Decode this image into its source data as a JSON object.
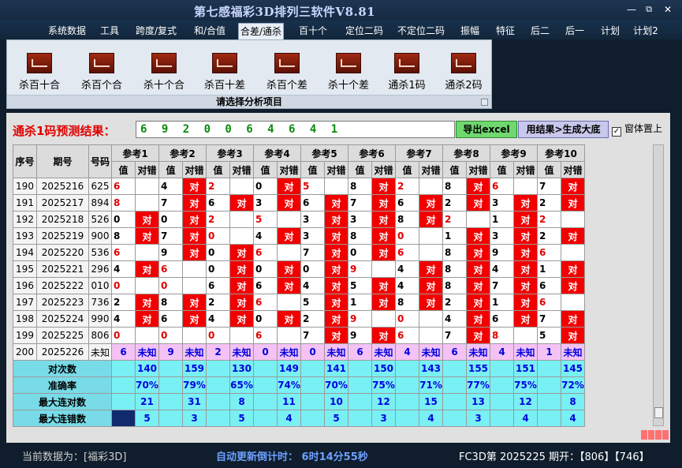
{
  "app": {
    "title": "第七感福彩3D排列三软件V8.81",
    "min": "—",
    "max": "⧉",
    "close": "✕"
  },
  "menu": [
    "系统数据",
    "工具",
    "跨度/复式",
    "和/合值",
    "合差/通杀",
    "百十个",
    "定位二码",
    "不定位二码",
    "振幅",
    "特征",
    "后二",
    "后一",
    "计划",
    "计划2"
  ],
  "menu_active": "合差/通杀",
  "ribbon": {
    "buttons": [
      "杀百十合",
      "杀百个合",
      "杀十个合",
      "杀百十差",
      "杀百个差",
      "杀十个差",
      "通杀1码",
      "通杀2码"
    ],
    "caption": "请选择分析项目"
  },
  "prediction": {
    "label": "通杀1码预测结果：",
    "value": "6 9 2 0 0 6 4 6 4 1",
    "export_label": "导出excel",
    "generate_label": "用结果>生成大底",
    "topmost_label": "窗体置上",
    "topmost_checked": true
  },
  "table": {
    "headers": {
      "seq": "序号",
      "period": "期号",
      "number": "号码",
      "ref_prefix": "参考",
      "value": "值",
      "result": "对错"
    },
    "refs": [
      "参考1",
      "参考2",
      "参考3",
      "参考4",
      "参考5",
      "参考6",
      "参考7",
      "参考8",
      "参考9",
      "参考10"
    ],
    "hit_text": "对",
    "rows": [
      {
        "seq": "190",
        "period": "2025216",
        "number": "625",
        "cells": [
          [
            "6",
            0
          ],
          [
            "4",
            1
          ],
          [
            "2",
            0
          ],
          [
            "0",
            1
          ],
          [
            "5",
            0
          ],
          [
            "8",
            1
          ],
          [
            "2",
            0
          ],
          [
            "8",
            1
          ],
          [
            "6",
            0
          ],
          [
            "7",
            1
          ]
        ]
      },
      {
        "seq": "191",
        "period": "2025217",
        "number": "894",
        "cells": [
          [
            "8",
            0
          ],
          [
            "7",
            1
          ],
          [
            "6",
            1
          ],
          [
            "3",
            1
          ],
          [
            "6",
            1
          ],
          [
            "7",
            1
          ],
          [
            "6",
            1
          ],
          [
            "2",
            1
          ],
          [
            "3",
            1
          ],
          [
            "2",
            1
          ]
        ]
      },
      {
        "seq": "192",
        "period": "2025218",
        "number": "526",
        "cells": [
          [
            "0",
            1
          ],
          [
            "0",
            1
          ],
          [
            "2",
            0
          ],
          [
            "5",
            0
          ],
          [
            "3",
            1
          ],
          [
            "3",
            1
          ],
          [
            "8",
            1
          ],
          [
            "2",
            0
          ],
          [
            "1",
            1
          ],
          [
            "2",
            0
          ]
        ]
      },
      {
        "seq": "193",
        "period": "2025219",
        "number": "900",
        "cells": [
          [
            "8",
            1
          ],
          [
            "7",
            1
          ],
          [
            "0",
            0
          ],
          [
            "4",
            1
          ],
          [
            "3",
            1
          ],
          [
            "8",
            1
          ],
          [
            "0",
            0
          ],
          [
            "1",
            1
          ],
          [
            "3",
            1
          ],
          [
            "2",
            1
          ]
        ]
      },
      {
        "seq": "194",
        "period": "2025220",
        "number": "536",
        "cells": [
          [
            "6",
            0
          ],
          [
            "9",
            1
          ],
          [
            "0",
            1
          ],
          [
            "6",
            0
          ],
          [
            "7",
            1
          ],
          [
            "0",
            1
          ],
          [
            "6",
            0
          ],
          [
            "8",
            1
          ],
          [
            "9",
            1
          ],
          [
            "6",
            0
          ]
        ]
      },
      {
        "seq": "195",
        "period": "2025221",
        "number": "296",
        "cells": [
          [
            "4",
            1
          ],
          [
            "6",
            0
          ],
          [
            "0",
            1
          ],
          [
            "0",
            1
          ],
          [
            "0",
            1
          ],
          [
            "9",
            0
          ],
          [
            "4",
            1
          ],
          [
            "8",
            1
          ],
          [
            "4",
            1
          ],
          [
            "1",
            1
          ]
        ]
      },
      {
        "seq": "196",
        "period": "2025222",
        "number": "010",
        "cells": [
          [
            "0",
            0
          ],
          [
            "0",
            0
          ],
          [
            "6",
            1
          ],
          [
            "6",
            1
          ],
          [
            "4",
            1
          ],
          [
            "5",
            1
          ],
          [
            "4",
            1
          ],
          [
            "8",
            1
          ],
          [
            "7",
            1
          ],
          [
            "6",
            1
          ]
        ]
      },
      {
        "seq": "197",
        "period": "2025223",
        "number": "736",
        "cells": [
          [
            "2",
            1
          ],
          [
            "8",
            1
          ],
          [
            "2",
            1
          ],
          [
            "6",
            0
          ],
          [
            "5",
            1
          ],
          [
            "1",
            1
          ],
          [
            "8",
            1
          ],
          [
            "2",
            1
          ],
          [
            "1",
            1
          ],
          [
            "6",
            0
          ]
        ]
      },
      {
        "seq": "198",
        "period": "2025224",
        "number": "990",
        "cells": [
          [
            "4",
            1
          ],
          [
            "6",
            1
          ],
          [
            "4",
            1
          ],
          [
            "0",
            1
          ],
          [
            "2",
            1
          ],
          [
            "9",
            0
          ],
          [
            "0",
            0
          ],
          [
            "4",
            1
          ],
          [
            "6",
            1
          ],
          [
            "7",
            1
          ]
        ]
      },
      {
        "seq": "199",
        "period": "2025225",
        "number": "806",
        "cells": [
          [
            "0",
            0
          ],
          [
            "0",
            0
          ],
          [
            "0",
            0
          ],
          [
            "6",
            0
          ],
          [
            "7",
            1
          ],
          [
            "9",
            1
          ],
          [
            "6",
            0
          ],
          [
            "7",
            1
          ],
          [
            "8",
            0
          ],
          [
            "5",
            1
          ]
        ]
      }
    ],
    "predict_row": {
      "seq": "200",
      "period": "2025226",
      "number": "未知",
      "values": [
        "6",
        "9",
        "2",
        "0",
        "0",
        "6",
        "4",
        "6",
        "4",
        "1"
      ],
      "result_text": "未知"
    },
    "stats": [
      {
        "label": "对次数",
        "values": [
          "140",
          "159",
          "130",
          "149",
          "141",
          "150",
          "143",
          "155",
          "151",
          "145"
        ]
      },
      {
        "label": "准确率",
        "values": [
          "70%",
          "79%",
          "65%",
          "74%",
          "70%",
          "75%",
          "71%",
          "77%",
          "75%",
          "72%"
        ]
      },
      {
        "label": "最大连对数",
        "values": [
          "21",
          "31",
          "8",
          "11",
          "10",
          "12",
          "15",
          "13",
          "12",
          "8"
        ]
      },
      {
        "label": "最大连错数",
        "values": [
          "5",
          "3",
          "5",
          "4",
          "5",
          "3",
          "4",
          "3",
          "4",
          "4"
        ]
      }
    ]
  },
  "status": {
    "current": "当前数据为：[福彩3D]",
    "countdown": "自动更新倒计时：  6时14分55秒",
    "draw": "FC3D第 2025225 期开：【806】【746】"
  },
  "colors": {
    "hit": "#f20000",
    "predict": "#f4c2f4",
    "stat": "#79f0f4",
    "accent": "#e00000",
    "value_blue": "#0000e0"
  }
}
